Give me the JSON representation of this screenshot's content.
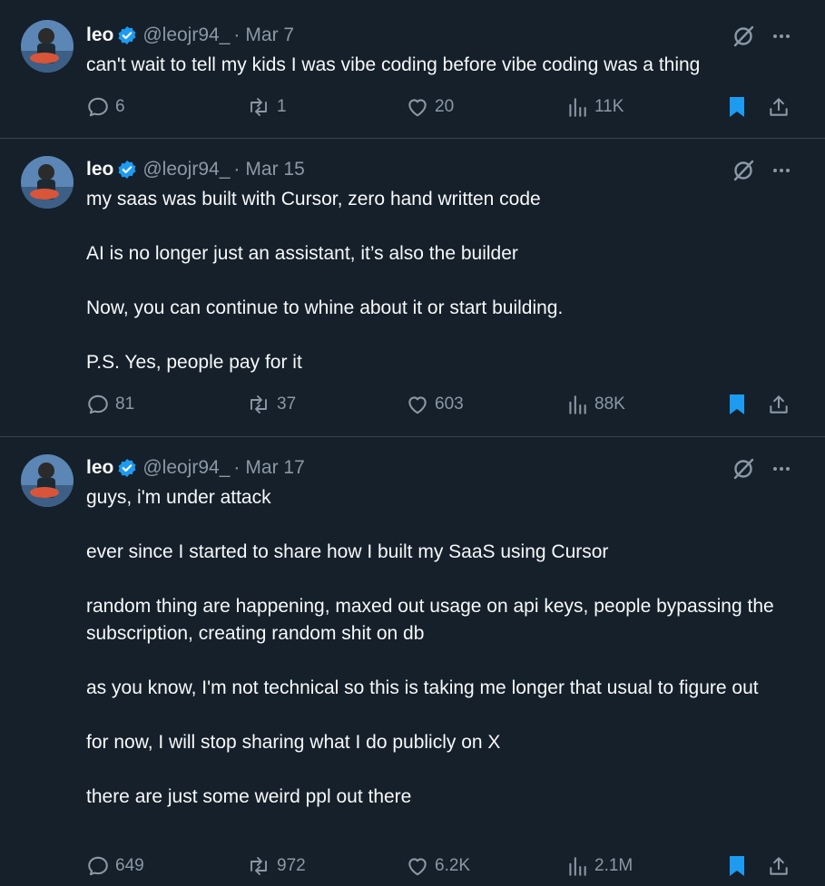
{
  "tweets": [
    {
      "name": "leo",
      "handle": "@leojr94_",
      "separator": "·",
      "date": "Mar 7",
      "paragraphs": [
        "can't wait to tell my kids I was vibe coding before vibe coding was a thing"
      ],
      "replies": "6",
      "reposts": "1",
      "likes": "20",
      "views": "11K"
    },
    {
      "name": "leo",
      "handle": "@leojr94_",
      "separator": "·",
      "date": "Mar 15",
      "paragraphs": [
        "my saas was built with Cursor, zero hand written code",
        "AI is no longer just an assistant, it’s also the builder",
        "Now, you can continue to whine about it or start building.",
        "P.S. Yes, people pay for it"
      ],
      "replies": "81",
      "reposts": "37",
      "likes": "603",
      "views": "88K"
    },
    {
      "name": "leo",
      "handle": "@leojr94_",
      "separator": "·",
      "date": "Mar 17",
      "paragraphs": [
        "guys, i'm under attack",
        "ever since I started to share how I built my SaaS using Cursor",
        "random thing are happening, maxed out usage on api keys, people bypassing the subscription, creating random shit on db",
        "as you know, I'm not technical so this is taking me longer that usual to figure out",
        "for now, I will stop sharing what I do publicly on X",
        "there are just some weird ppl out there"
      ],
      "replies": "649",
      "reposts": "972",
      "likes": "6.2K",
      "views": "2.1M"
    }
  ],
  "colors": {
    "background": "#15202b",
    "text": "#f7f9f9",
    "muted": "#8b98a5",
    "accent": "#1d9bf0",
    "divider": "#38444d"
  },
  "icons": [
    "verified-badge-icon",
    "grok-icon",
    "more-icon",
    "reply-icon",
    "repost-icon",
    "like-icon",
    "views-icon",
    "bookmark-icon",
    "share-icon"
  ]
}
